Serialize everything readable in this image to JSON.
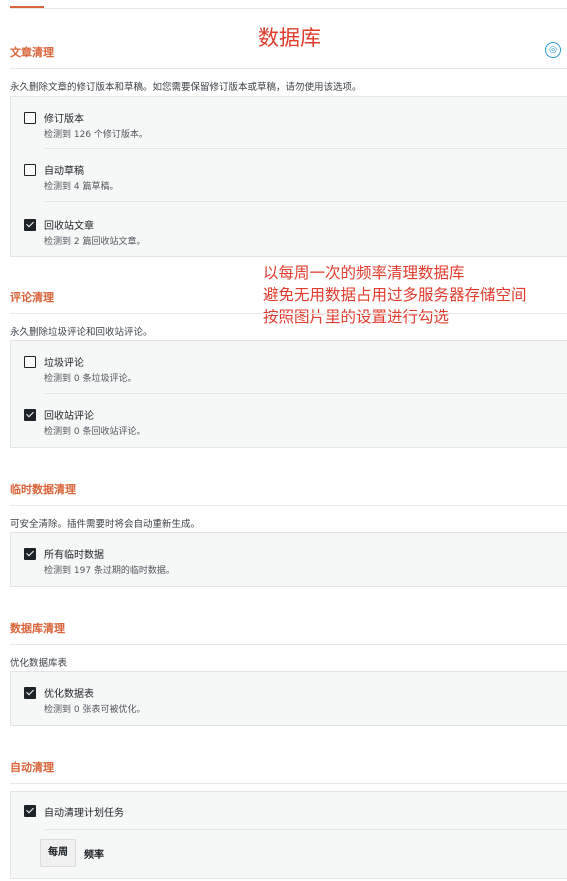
{
  "annotation_title": "数据库",
  "annotation_lines": [
    "以每周一次的频率清理数据库",
    "避免无用数据占用过多服务器存储空间",
    "按照图片里的设置进行勾选"
  ],
  "sections": {
    "post": {
      "title": "文章清理",
      "desc": "永久删除文章的修订版本和草稿。如您需要保留修订版本或草稿，请勿使用该选项。",
      "options": [
        {
          "label": "修订版本",
          "desc": "检测到 126 个修订版本。",
          "checked": false
        },
        {
          "label": "自动草稿",
          "desc": "检测到 4 篇草稿。",
          "checked": false
        },
        {
          "label": "回收站文章",
          "desc": "检测到 2 篇回收站文章。",
          "checked": true
        }
      ]
    },
    "comment": {
      "title": "评论清理",
      "desc": "永久删除垃圾评论和回收站评论。",
      "options": [
        {
          "label": "垃圾评论",
          "desc": "检测到 0 条垃圾评论。",
          "checked": false
        },
        {
          "label": "回收站评论",
          "desc": "检测到 0 条回收站评论。",
          "checked": true
        }
      ]
    },
    "transient": {
      "title": "临时数据清理",
      "desc": "可安全清除。插件需要时将会自动重新生成。",
      "options": [
        {
          "label": "所有临时数据",
          "desc": "检测到 197 条过期的临时数据。",
          "checked": true
        }
      ]
    },
    "database": {
      "title": "数据库清理",
      "desc": "优化数据库表",
      "options": [
        {
          "label": "优化数据表",
          "desc": "检测到 0 张表可被优化。",
          "checked": true
        }
      ]
    },
    "auto": {
      "title": "自动清理",
      "options": [
        {
          "label": "自动清理计划任务",
          "checked": true
        }
      ],
      "frequency_value": "每周",
      "frequency_label": "频率"
    }
  },
  "colors": {
    "accent": "#d9643a",
    "annotation": "#e03b2c",
    "help_icon": "#2a9ad8"
  },
  "icons": {
    "help": "lifebuoy-icon",
    "checkbox": "checkbox-icon"
  }
}
